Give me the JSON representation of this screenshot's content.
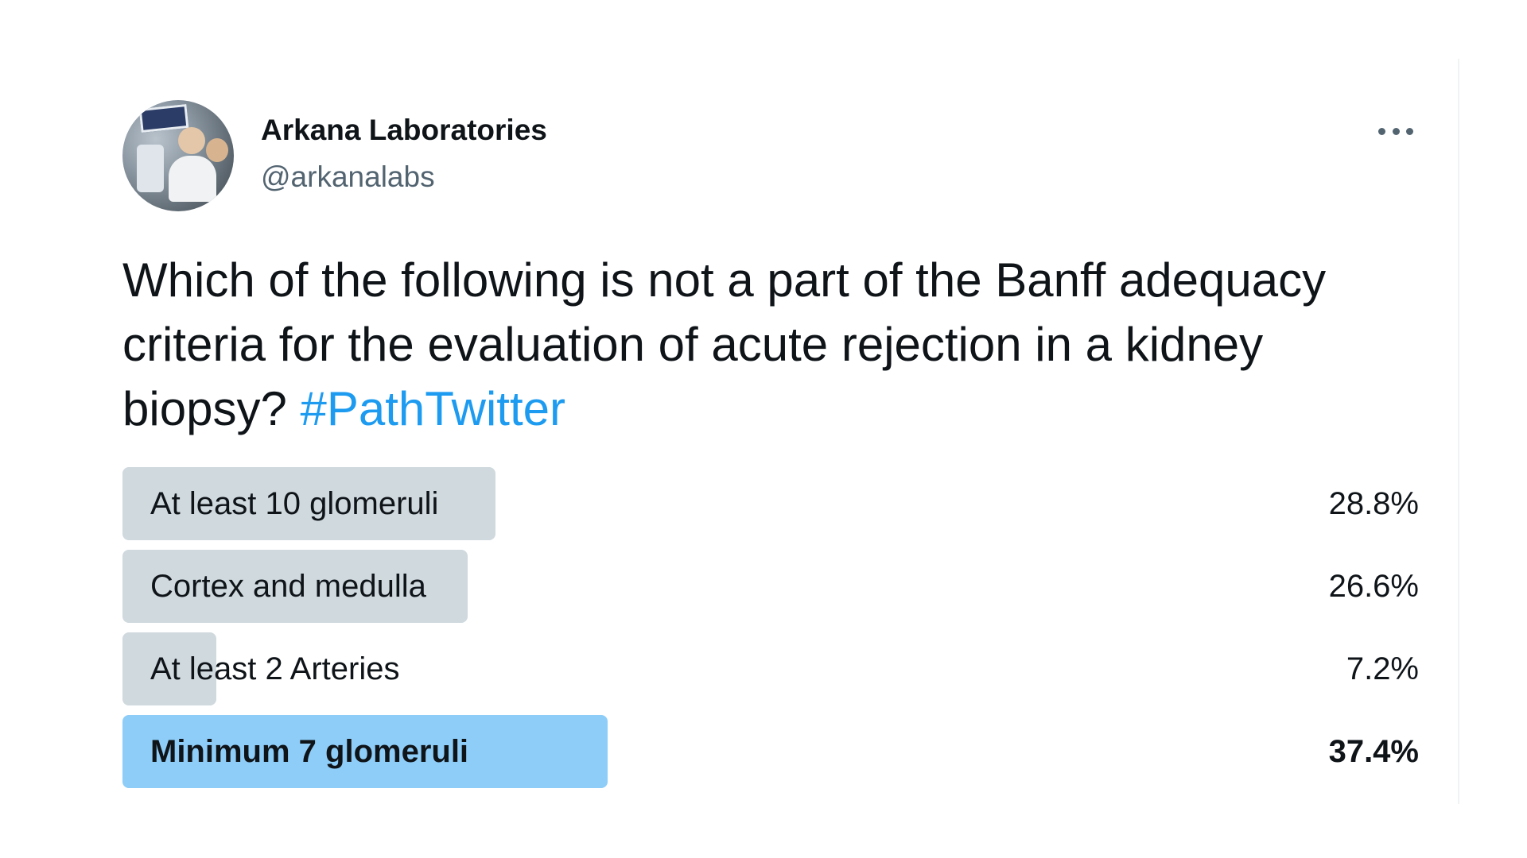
{
  "author": {
    "display_name": "Arkana Laboratories",
    "handle": "@arkanalabs"
  },
  "tweet": {
    "text": "Which of the following is not a part of the Banff adequacy criteria for the evaluation of acute rejection in a kidney biopsy? ",
    "hashtag": "#PathTwitter"
  },
  "poll": {
    "options": [
      {
        "label": "At least 10 glomeruli",
        "percent": "28.8%",
        "fraction": 0.288,
        "winner": false
      },
      {
        "label": "Cortex and medulla",
        "percent": "26.6%",
        "fraction": 0.266,
        "winner": false
      },
      {
        "label": "At least 2 Arteries",
        "percent": "7.2%",
        "fraction": 0.072,
        "winner": false
      },
      {
        "label": "Minimum 7 glomeruli",
        "percent": "37.4%",
        "fraction": 0.374,
        "winner": true
      }
    ]
  },
  "icons": {
    "more": "more-options-icon"
  },
  "colors": {
    "hashtag": "#1d9bf0",
    "poll_bar": "#cfd9de",
    "poll_bar_winner": "#8ecdf8",
    "secondary_text": "#536471"
  }
}
